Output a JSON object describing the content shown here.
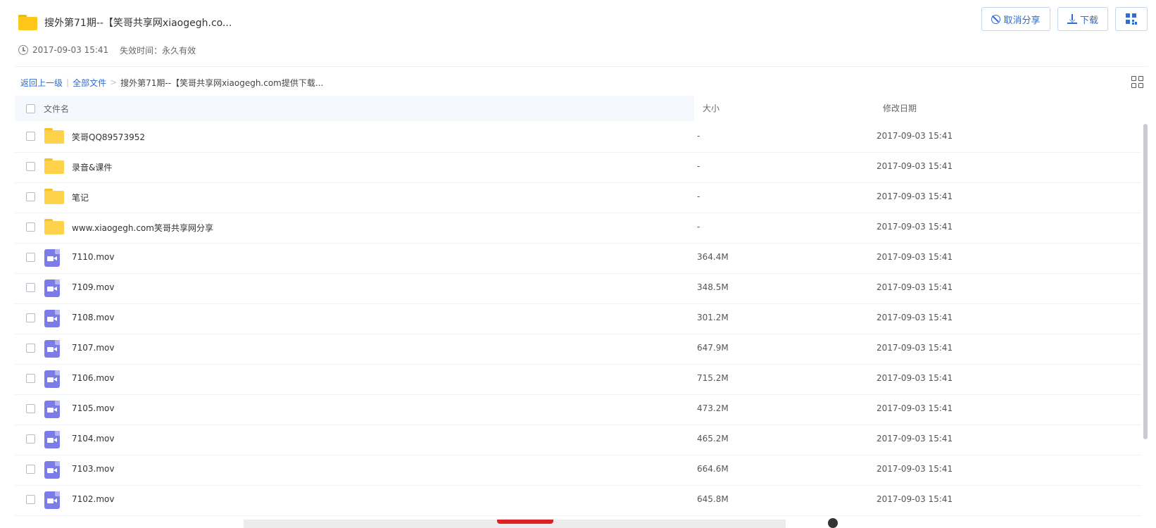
{
  "share": {
    "title": "搜外第71期--【笑哥共享网xiaogegh.co...",
    "created": "2017-09-03 15:41",
    "expire": "失效时间：永久有效"
  },
  "toolbar": {
    "cancel_label": "取消分享",
    "download_label": "下载"
  },
  "breadcrumb": {
    "back": "返回上一级",
    "separator": "|",
    "root": "全部文件",
    "arrow": ">",
    "current": "搜外第71期--【笑哥共享网xiaogegh.com提供下载..."
  },
  "columns": {
    "name": "文件名",
    "size": "大小",
    "date": "修改日期"
  },
  "files": [
    {
      "name": "笑哥QQ89573952",
      "size": "-",
      "date": "2017-09-03 15:41",
      "icon": "folder-icon"
    },
    {
      "name": "录音&课件",
      "size": "-",
      "date": "2017-09-03 15:41",
      "icon": "folder-icon"
    },
    {
      "name": "笔记",
      "size": "-",
      "date": "2017-09-03 15:41",
      "icon": "folder-icon"
    },
    {
      "name": "www.xiaogegh.com笑哥共享网分享",
      "size": "-",
      "date": "2017-09-03 15:41",
      "icon": "folder-icon"
    },
    {
      "name": "7110.mov",
      "size": "364.4M",
      "date": "2017-09-03 15:41",
      "icon": "video-file-icon"
    },
    {
      "name": "7109.mov",
      "size": "348.5M",
      "date": "2017-09-03 15:41",
      "icon": "video-file-icon"
    },
    {
      "name": "7108.mov",
      "size": "301.2M",
      "date": "2017-09-03 15:41",
      "icon": "video-file-icon"
    },
    {
      "name": "7107.mov",
      "size": "647.9M",
      "date": "2017-09-03 15:41",
      "icon": "video-file-icon"
    },
    {
      "name": "7106.mov",
      "size": "715.2M",
      "date": "2017-09-03 15:41",
      "icon": "video-file-icon"
    },
    {
      "name": "7105.mov",
      "size": "473.2M",
      "date": "2017-09-03 15:41",
      "icon": "video-file-icon"
    },
    {
      "name": "7104.mov",
      "size": "465.2M",
      "date": "2017-09-03 15:41",
      "icon": "video-file-icon"
    },
    {
      "name": "7103.mov",
      "size": "664.6M",
      "date": "2017-09-03 15:41",
      "icon": "video-file-icon"
    },
    {
      "name": "7102.mov",
      "size": "645.8M",
      "date": "2017-09-03 15:41",
      "icon": "video-file-icon"
    }
  ],
  "colors": {
    "accent": "#2f6bd0",
    "folder": "#ffd24c",
    "video": "#7c7ce8",
    "header_bg": "#f5f8fd"
  }
}
